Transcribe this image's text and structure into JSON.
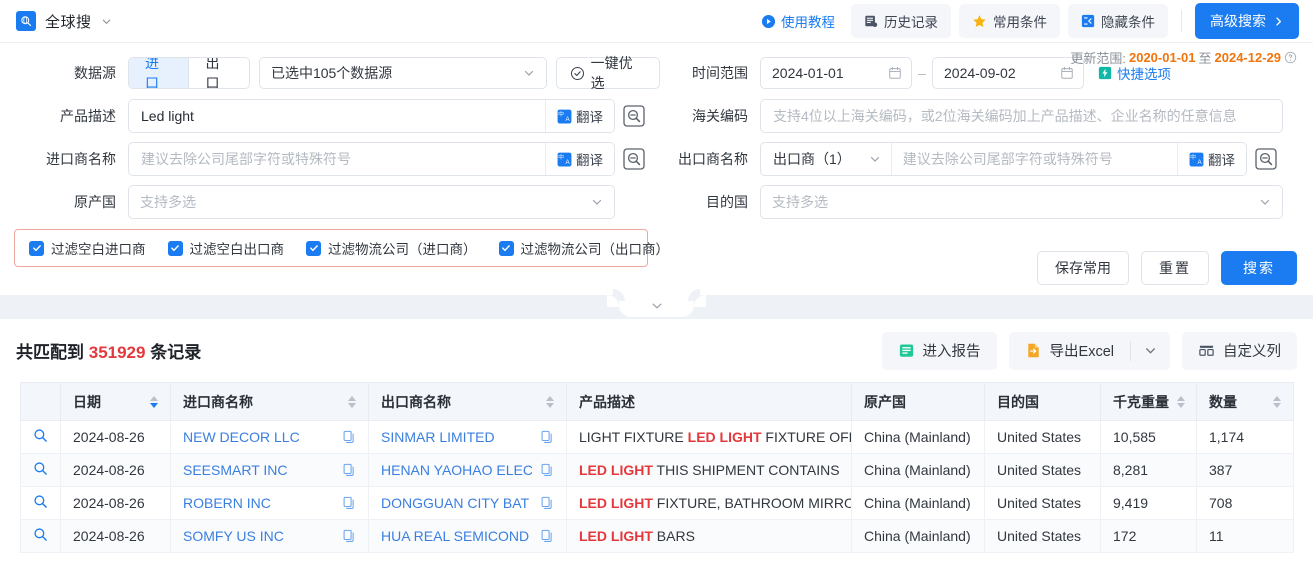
{
  "topbar": {
    "brand_icon": "globe-search-icon",
    "brand": "全球搜",
    "tutorial": "使用教程",
    "history": "历史记录",
    "favorites": "常用条件",
    "hidden_conditions": "隐藏条件",
    "advanced_search": "高级搜索"
  },
  "form": {
    "datasource_label": "数据源",
    "seg_import": "进口",
    "seg_export": "出口",
    "datasource_value": "已选中105个数据源",
    "optimize_btn": "一键优选",
    "product_desc_label": "产品描述",
    "product_desc_value": "Led light",
    "translate": "翻译",
    "importer_label": "进口商名称",
    "importer_placeholder": "建议去除公司尾部字符或特殊符号",
    "origin_label": "原产国",
    "origin_placeholder": "支持多选",
    "update_range_prefix": "更新范围:",
    "update_range_start": "2020-01-01",
    "update_range_to": "至",
    "update_range_end": "2024-12-29",
    "time_range_label": "时间范围",
    "date_start": "2024-01-01",
    "date_end": "2024-09-02",
    "quick_options": "快捷选项",
    "hscode_label": "海关编码",
    "hscode_placeholder": "支持4位以上海关编码，或2位海关编码加上产品描述、企业名称的任意信息",
    "exporter_label": "出口商名称",
    "exporter_select": "出口商（1）",
    "exporter_placeholder": "建议去除公司尾部字符或特殊符号",
    "dest_label": "目的国",
    "dest_placeholder": "支持多选",
    "checkboxes": [
      "过滤空白进口商",
      "过滤空白出口商",
      "过滤物流公司（进口商）",
      "过滤物流公司（出口商）"
    ],
    "save_btn": "保存常用",
    "reset_btn": "重置",
    "search_btn": "搜索"
  },
  "results": {
    "count_prefix": "共匹配到",
    "count": "351929",
    "count_suffix": "条记录",
    "report_btn": "进入报告",
    "export_btn": "导出Excel",
    "custom_columns_btn": "自定义列",
    "columns": [
      {
        "label": "日期",
        "sortable": true,
        "active_sort": "desc"
      },
      {
        "label": "进口商名称",
        "sortable": true
      },
      {
        "label": "出口商名称",
        "sortable": true
      },
      {
        "label": "产品描述",
        "sortable": false
      },
      {
        "label": "原产国",
        "sortable": false
      },
      {
        "label": "目的国",
        "sortable": false
      },
      {
        "label": "千克重量",
        "sortable": true
      },
      {
        "label": "数量",
        "sortable": true
      }
    ],
    "rows": [
      {
        "date": "2024-08-26",
        "importer": "NEW DECOR LLC",
        "exporter": "SINMAR LIMITED",
        "desc_pre": "LIGHT FIXTURE ",
        "desc_hl": "LED LIGHT",
        "desc_post": " FIXTURE OFFI",
        "origin": "China (Mainland)",
        "dest": "United States",
        "weight": "10,585",
        "qty": "1,174"
      },
      {
        "date": "2024-08-26",
        "importer": "SEESMART INC",
        "exporter": "HENAN YAOHAO ELEC",
        "desc_pre": "",
        "desc_hl": "LED LIGHT",
        "desc_post": " THIS SHIPMENT CONTAINS",
        "origin": "China (Mainland)",
        "dest": "United States",
        "weight": "8,281",
        "qty": "387"
      },
      {
        "date": "2024-08-26",
        "importer": "ROBERN INC",
        "exporter": "DONGGUAN CITY BAT",
        "desc_pre": "",
        "desc_hl": "LED LIGHT",
        "desc_post": " FIXTURE, BATHROOM MIRRO",
        "origin": "China (Mainland)",
        "dest": "United States",
        "weight": "9,419",
        "qty": "708"
      },
      {
        "date": "2024-08-26",
        "importer": "SOMFY US INC",
        "exporter": "HUA REAL SEMICOND",
        "desc_pre": "",
        "desc_hl": "LED LIGHT",
        "desc_post": " BARS",
        "origin": "China (Mainland)",
        "dest": "United States",
        "weight": "172",
        "qty": "11"
      }
    ]
  },
  "colors": {
    "accent": "#1a7cf0",
    "danger": "#e4393c",
    "warn": "#f2740c"
  }
}
